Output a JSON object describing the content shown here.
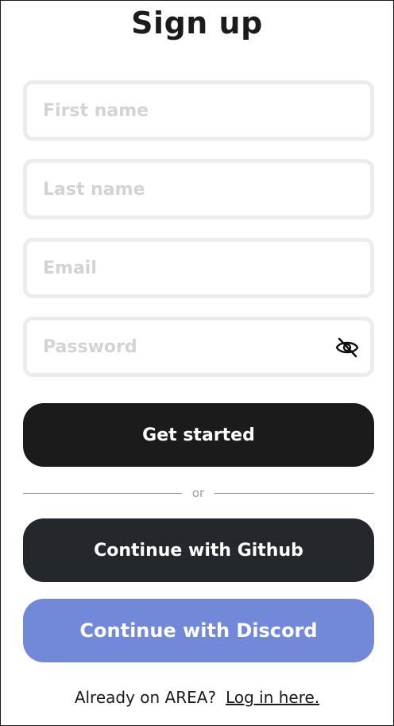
{
  "page": {
    "title": "Sign up"
  },
  "form": {
    "first_name_placeholder": "First name",
    "last_name_placeholder": "Last name",
    "email_placeholder": "Email",
    "password_placeholder": "Password",
    "password_toggle_icon": "eye-slash-icon"
  },
  "buttons": {
    "get_started": "Get started",
    "github": "Continue with Github",
    "discord": "Continue with Discord"
  },
  "divider": {
    "text": "or"
  },
  "footer": {
    "prompt": "Already on AREA?",
    "login_link": "Log in here."
  },
  "colors": {
    "primary_button": "#1b1b1b",
    "github_button": "#24282d",
    "discord_button": "#7289da",
    "field_border": "#ececec",
    "placeholder": "#d3d3d3"
  }
}
